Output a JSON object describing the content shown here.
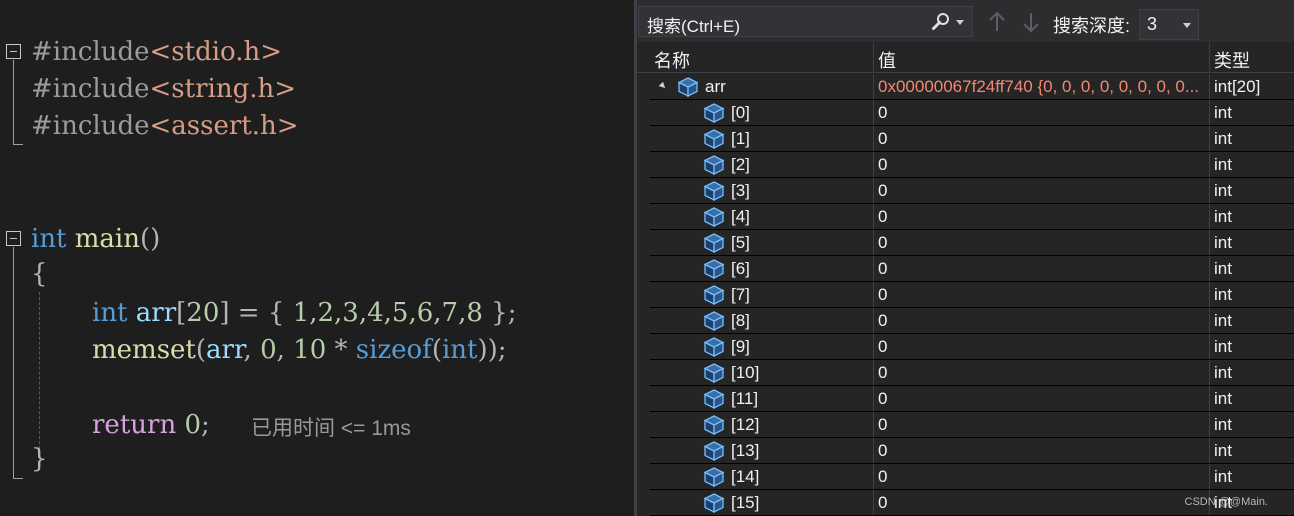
{
  "editor": {
    "includes": [
      {
        "directive": "#include",
        "header": "<stdio.h>"
      },
      {
        "directive": "#include",
        "header": "<string.h>"
      },
      {
        "directive": "#include",
        "header": "<assert.h>"
      }
    ],
    "main_sig": {
      "ret": "int",
      "name": "main",
      "parens": "()"
    },
    "open_brace": "{",
    "line_arr": {
      "type": "int",
      "var": "arr",
      "bracket_open": "[",
      "size": "20",
      "bracket_close": "]",
      "eq": " = ",
      "brace_open": "{ ",
      "values": "1,2,3,4,5,6,7,8",
      "brace_close": " }",
      "semi": ";"
    },
    "line_memset": {
      "fn": "memset",
      "open": "(",
      "arg1": "arr",
      "comma1": ", ",
      "arg2": "0",
      "comma2": ", ",
      "arg3": "10",
      "mul": " * ",
      "sizeof": "sizeof",
      "open2": "(",
      "type": "int",
      "close": "));"
    },
    "line_return": {
      "kw": "return",
      "num": " 0",
      "semi": ";"
    },
    "elapsed_hint": "已用时间 <= 1ms",
    "close_brace": "}"
  },
  "watch": {
    "search_placeholder": "搜索(Ctrl+E)",
    "search_icon": "magnifier-icon",
    "depth_label": "搜索深度:",
    "depth_value": "3",
    "columns": {
      "name": "名称",
      "value": "值",
      "type": "类型"
    },
    "root": {
      "name": "arr",
      "value": "0x00000067f24ff740 {0, 0, 0, 0, 0, 0, 0, 0...",
      "type": "int[20]"
    },
    "items": [
      {
        "name": "[0]",
        "value": "0",
        "type": "int"
      },
      {
        "name": "[1]",
        "value": "0",
        "type": "int"
      },
      {
        "name": "[2]",
        "value": "0",
        "type": "int"
      },
      {
        "name": "[3]",
        "value": "0",
        "type": "int"
      },
      {
        "name": "[4]",
        "value": "0",
        "type": "int"
      },
      {
        "name": "[5]",
        "value": "0",
        "type": "int"
      },
      {
        "name": "[6]",
        "value": "0",
        "type": "int"
      },
      {
        "name": "[7]",
        "value": "0",
        "type": "int"
      },
      {
        "name": "[8]",
        "value": "0",
        "type": "int"
      },
      {
        "name": "[9]",
        "value": "0",
        "type": "int"
      },
      {
        "name": "[10]",
        "value": "0",
        "type": "int"
      },
      {
        "name": "[11]",
        "value": "0",
        "type": "int"
      },
      {
        "name": "[12]",
        "value": "0",
        "type": "int"
      },
      {
        "name": "[13]",
        "value": "0",
        "type": "int"
      },
      {
        "name": "[14]",
        "value": "0",
        "type": "int"
      },
      {
        "name": "[15]",
        "value": "0",
        "type": "int"
      }
    ]
  },
  "watermark": "CSDN @@Main."
}
